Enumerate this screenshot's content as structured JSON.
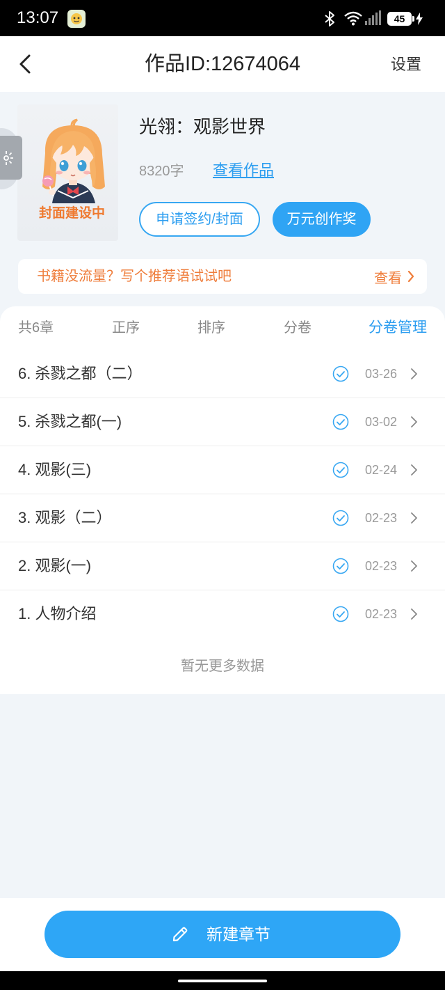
{
  "status_bar": {
    "time": "13:07",
    "battery": "45"
  },
  "header": {
    "title": "作品ID:12674064",
    "settings_label": "设置"
  },
  "book": {
    "cover_text": "封面建设中",
    "title": "光翎：观影世界",
    "word_count": "8320字",
    "view_link": "查看作品",
    "apply_button": "申请签约/封面",
    "award_button": "万元创作奖"
  },
  "banner": {
    "text": "书籍没流量？写个推荐语试试吧",
    "action": "查看"
  },
  "toolbar": {
    "count": "共6章",
    "order": "正序",
    "sort": "排序",
    "volume": "分卷",
    "volume_manage": "分卷管理"
  },
  "chapters": [
    {
      "title": "6. 杀戮之都（二）",
      "date": "03-26",
      "status_icon": "check-circle-icon"
    },
    {
      "title": "5. 杀戮之都(一)",
      "date": "03-02",
      "status_icon": "check-circle-icon"
    },
    {
      "title": "4. 观影(三)",
      "date": "02-24",
      "status_icon": "check-circle-icon"
    },
    {
      "title": "3. 观影（二）",
      "date": "02-23",
      "status_icon": "check-circle-icon"
    },
    {
      "title": "2. 观影(一)",
      "date": "02-23",
      "status_icon": "check-circle-icon"
    },
    {
      "title": "1. 人物介绍",
      "date": "02-23",
      "status_icon": "check-circle-icon"
    }
  ],
  "empty_text": "暂无更多数据",
  "footer": {
    "new_chapter": "新建章节"
  },
  "icons": {
    "back": "chevron-left-icon",
    "row_arrow": "chevron-right-icon",
    "new_chapter": "pencil-icon",
    "side_float": "sparkle-icon",
    "status": [
      "app-notification-icon",
      "bluetooth-icon",
      "wifi-icon",
      "signal-icon",
      "battery-icon",
      "charging-icon"
    ]
  },
  "colors": {
    "accent": "#2fa4f4",
    "promo_text": "#ef7d3b",
    "page_background": "#f1f5f9",
    "cover_text": "#ef7a30"
  }
}
